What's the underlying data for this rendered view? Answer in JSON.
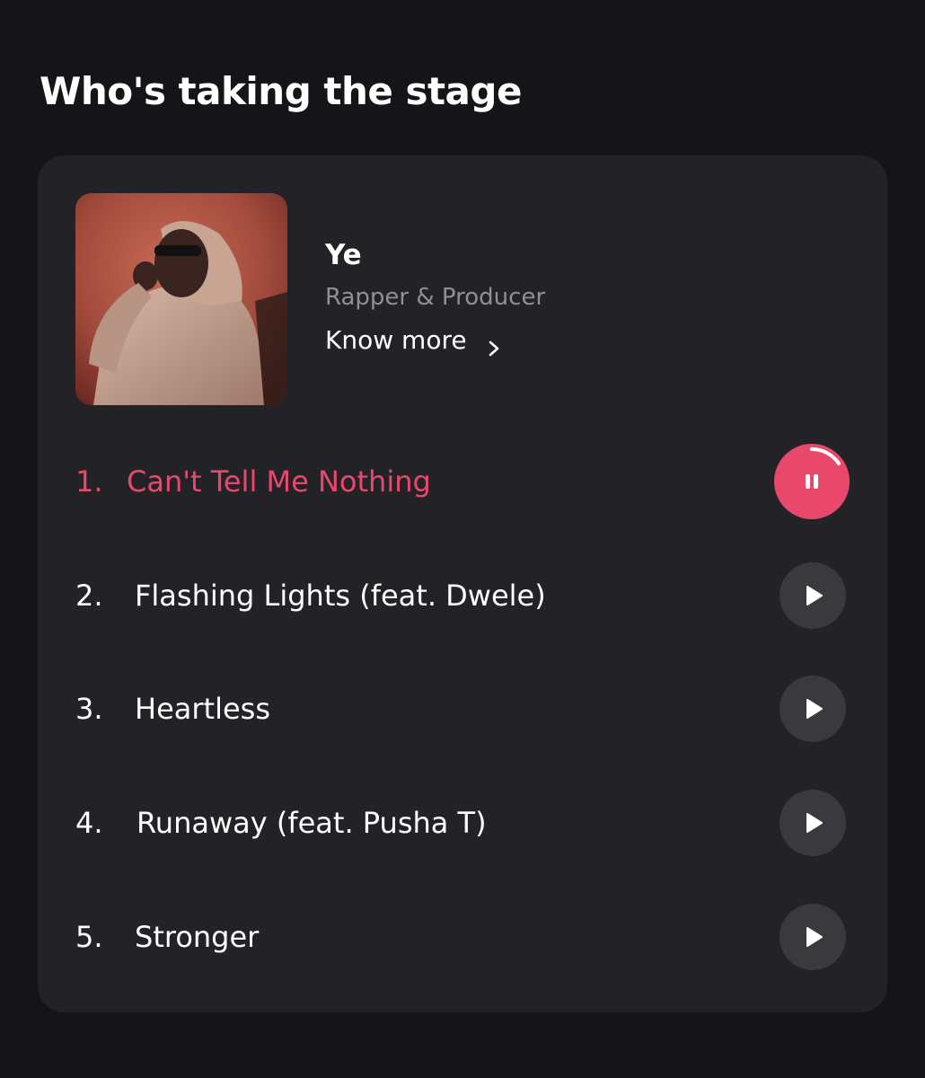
{
  "section": {
    "title": "Who's taking the stage"
  },
  "artist": {
    "name": "Ye",
    "role": "Rapper & Producer",
    "know_more_label": "Know more",
    "photo_icon": "artist-photo"
  },
  "tracks": [
    {
      "number": "1.",
      "title": "Can't Tell Me Nothing",
      "state": "playing"
    },
    {
      "number": "2.",
      "title": "Flashing Lights (feat. Dwele)",
      "state": "idle"
    },
    {
      "number": "3.",
      "title": "Heartless",
      "state": "idle"
    },
    {
      "number": "4.",
      "title": "Runaway (feat. Pusha T)",
      "state": "idle"
    },
    {
      "number": "5.",
      "title": "Stronger",
      "state": "idle"
    }
  ],
  "colors": {
    "background": "#151519",
    "card": "#232327",
    "accent": "#e8486c",
    "muted_text": "#8f8f96",
    "button_bg": "#3a3a3e"
  }
}
